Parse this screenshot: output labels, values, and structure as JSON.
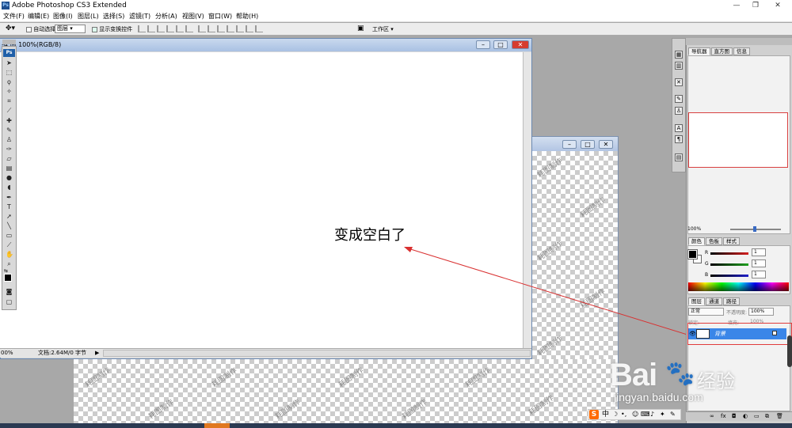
{
  "window": {
    "title": "Adobe Photoshop CS3 Extended",
    "app_icon": "Ps",
    "controls": [
      "—",
      "❐",
      "✕"
    ]
  },
  "menubar": {
    "items": [
      "文件(F)",
      "编辑(E)",
      "图像(I)",
      "图层(L)",
      "选择(S)",
      "滤镜(T)",
      "分析(A)",
      "视图(V)",
      "窗口(W)",
      "帮助(H)"
    ]
  },
  "options_bar": {
    "auto_select_label": "自动选择:",
    "auto_select_value": "图层",
    "show_transform_label": "显示变换控件",
    "workspace_label": "工作区"
  },
  "toolbox": {
    "badge": "Ps"
  },
  "doc1": {
    "title": "-4 @ 100%(RGB/8)",
    "zoom": "00%",
    "doc_info": "文档:2.64M/0 字节"
  },
  "annotation": {
    "text": "变成空白了"
  },
  "doc2": {
    "watermark": "耗图制作"
  },
  "panels": {
    "navigator_tabs": [
      "导航器",
      "直方图",
      "信息"
    ],
    "navigator_zoom": "100%",
    "color_tabs": [
      "颜色",
      "色板",
      "样式"
    ],
    "color_channels": [
      {
        "label": "R",
        "value": "1",
        "color": "#d42020"
      },
      {
        "label": "G",
        "value": "1",
        "color": "#20a020"
      },
      {
        "label": "B",
        "value": "1",
        "color": "#2020c8"
      }
    ],
    "layers_tabs": [
      "图层",
      "通道",
      "路径"
    ],
    "blend_mode": "正常",
    "opacity_label": "不透明度:",
    "opacity_value": "100%",
    "lock_label": "锁定:",
    "fill_label": "填充:",
    "fill_value": "100%",
    "layer_name": "背景"
  },
  "watermark": {
    "brand": "Bai",
    "brand_suffix": "du",
    "product": "经验",
    "url": "jingyan.baidu.com"
  },
  "ime": {
    "logo": "S",
    "mode": "中"
  },
  "colors": {
    "annotation_red": "#d93030",
    "layer_selected": "#3a86e8",
    "photoshop_blue": "#1f5fa8"
  }
}
